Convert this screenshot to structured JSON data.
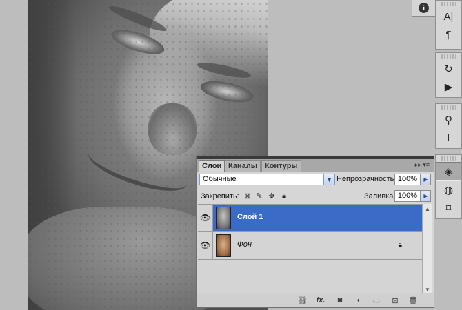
{
  "canvas": {
    "description_icon": "portrait-photo"
  },
  "right_dock": {
    "info_icon": "i",
    "groups": [
      {
        "buttons": [
          {
            "icon": "character-icon",
            "glyph": "A|"
          },
          {
            "icon": "paragraph-icon",
            "glyph": "¶"
          }
        ]
      },
      {
        "buttons": [
          {
            "icon": "history-brush-icon",
            "glyph": "↻"
          },
          {
            "icon": "actions-play-icon",
            "glyph": "▶"
          }
        ]
      },
      {
        "buttons": [
          {
            "icon": "clone-source-icon",
            "glyph": "⚲"
          },
          {
            "icon": "tool-presets-icon",
            "glyph": "⊥"
          }
        ]
      },
      {
        "buttons": [
          {
            "icon": "layers-icon",
            "glyph": "◈",
            "active": true
          },
          {
            "icon": "channels-icon",
            "glyph": "◍"
          },
          {
            "icon": "paths-icon",
            "glyph": "⌑"
          }
        ]
      }
    ]
  },
  "layers_panel": {
    "tabs": [
      "Слои",
      "Каналы",
      "Контуры"
    ],
    "active_tab": 0,
    "blend_mode": "Обычные",
    "opacity_label": "Непрозрачность:",
    "opacity_value": "100%",
    "lock_label": "Закрепить:",
    "fill_label": "Заливка:",
    "fill_value": "100%",
    "layers": [
      {
        "name": "Слой 1",
        "visible": true,
        "selected": true,
        "locked": false
      },
      {
        "name": "Фон",
        "visible": true,
        "selected": false,
        "locked": true
      }
    ],
    "footer_icons": [
      "link-icon",
      "fx-icon",
      "mask-icon",
      "adjustment-icon",
      "group-folder-icon",
      "new-layer-icon",
      "trash-icon"
    ],
    "footer_glyphs": {
      "fx": "fx."
    }
  }
}
